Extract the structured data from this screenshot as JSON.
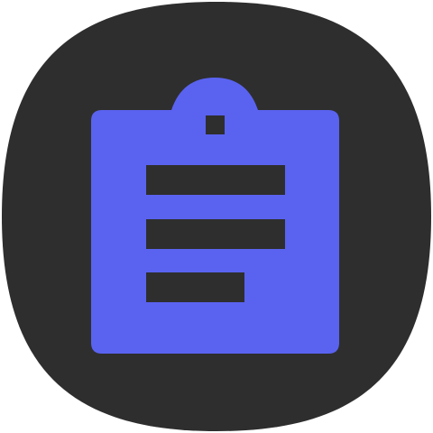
{
  "icon": {
    "name": "clipboard-notes-icon",
    "background_color": "#2e2e2e",
    "foreground_color": "#5a63f0"
  }
}
